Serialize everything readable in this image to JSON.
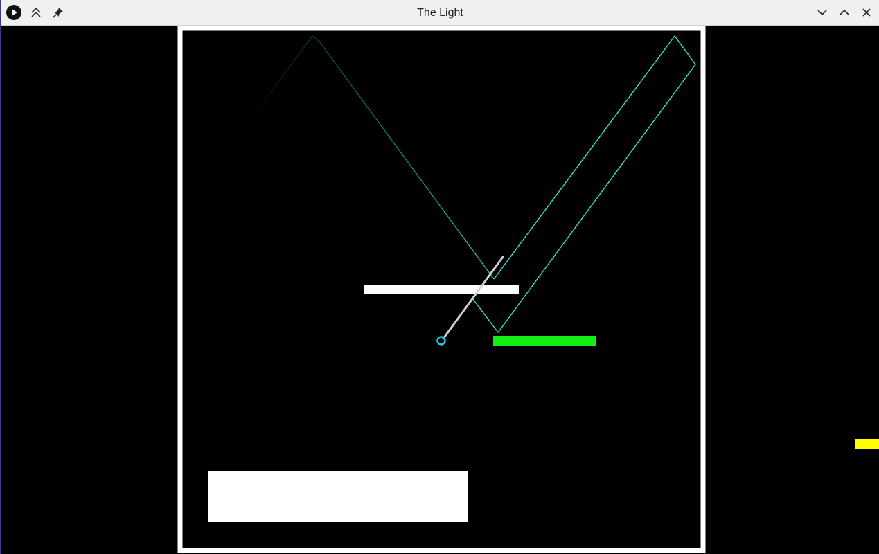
{
  "window": {
    "title": "The Light",
    "buttons": {
      "app_menu": "play-circle-icon",
      "keep_above": "keep-above-icon",
      "pin": "pin-icon",
      "minimize": "chevron-down-icon",
      "maximize": "chevron-up-icon",
      "close": "close-icon"
    }
  },
  "game": {
    "colors": {
      "background": "#000000",
      "wall": "#ffffff",
      "beam": "#2ee6d6",
      "target": "#11ee11",
      "goal": "#ffff00",
      "mirror": "#cfcfcf",
      "emitter": "#20c8e8"
    }
  }
}
